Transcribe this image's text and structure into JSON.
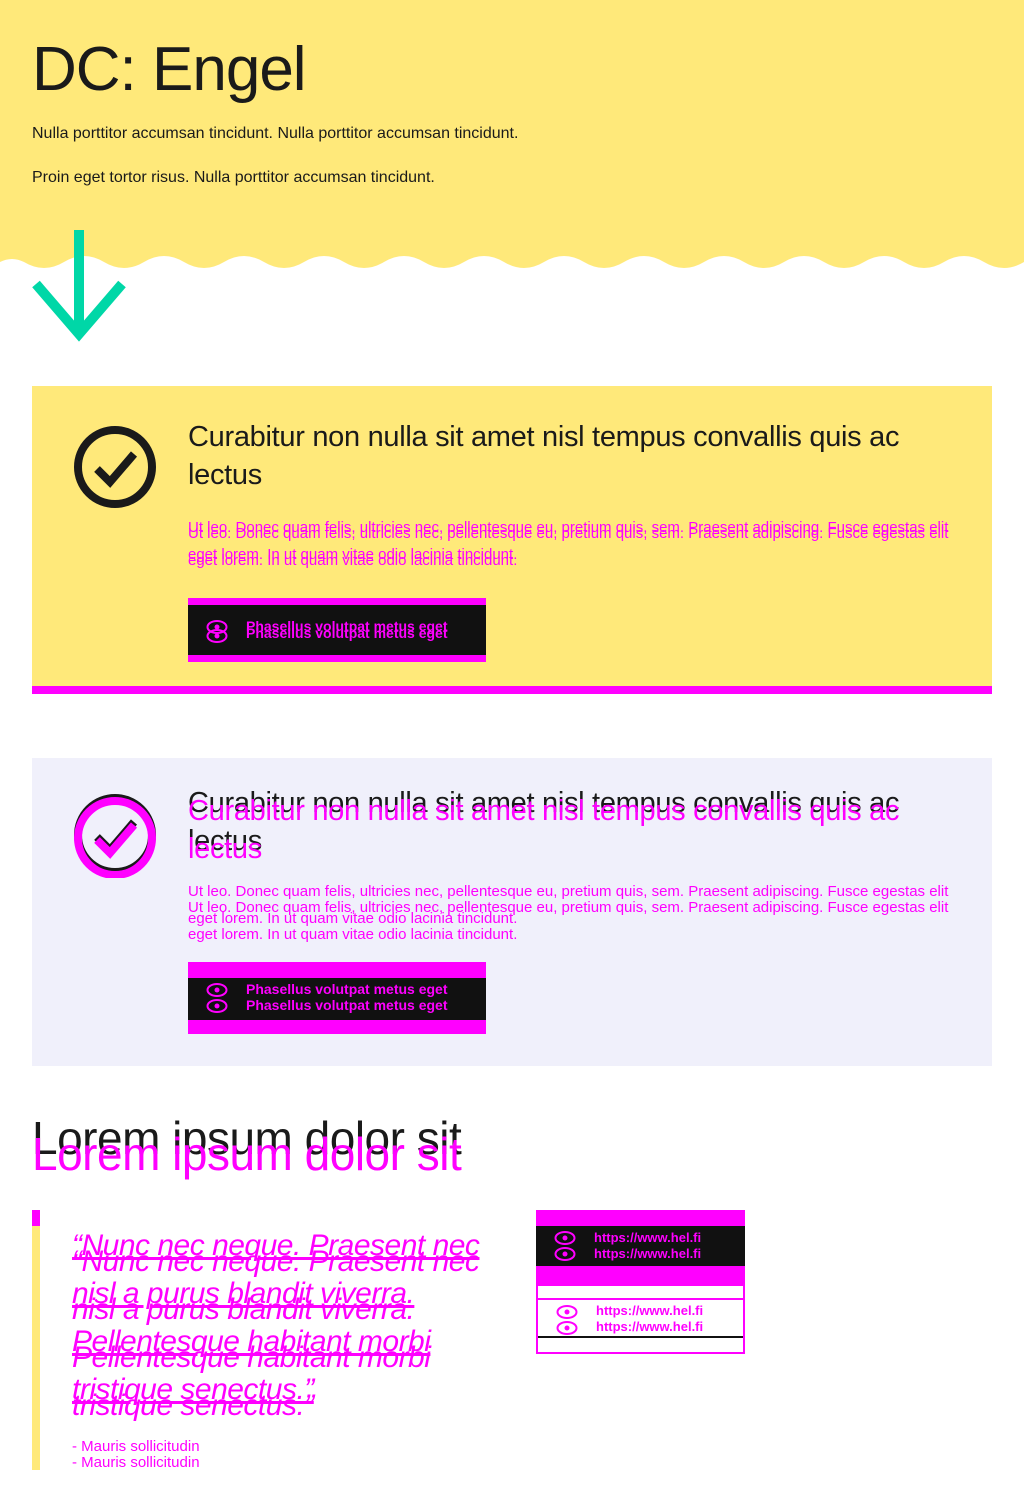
{
  "hero": {
    "title": "DC: Engel",
    "paragraph_1": "Nulla porttitor accumsan tincidunt. Nulla porttitor accumsan tincidunt.",
    "paragraph_2": "Proin eget tortor risus. Nulla porttitor accumsan tincidunt.",
    "background_color": "#ffe97a",
    "arrow_icon": "arrow-down-icon",
    "arrow_color": "#00d7a7"
  },
  "notification_1": {
    "icon": "check-circle-icon",
    "title": "Curabitur non nulla sit amet nisl tempus convallis quis ac lectus",
    "text": "Ut leo. Donec quam felis, ultricies nec, pellentesque eu, pretium quis, sem. Praesent adipiscing. Fusce egestas elit eget lorem. In ut quam vitae odio lacinia tincidunt.",
    "button_label": "Phasellus volutpat metus eget",
    "button_icon": "eye-icon",
    "background_color": "#ffe97a"
  },
  "notification_2": {
    "icon": "check-circle-icon",
    "title": "Curabitur non nulla sit amet nisl tempus convallis quis ac lectus",
    "text": "Ut leo. Donec quam felis, ultricies nec, pellentesque eu, pretium quis, sem. Praesent adipiscing. Fusce egestas elit eget lorem. In ut quam vitae odio lacinia tincidunt.",
    "button_label": "Phasellus volutpat metus eget",
    "button_icon": "eye-icon",
    "background_color": "#f0f0fb"
  },
  "section": {
    "title": "Lorem ipsum dolor sit"
  },
  "quote": {
    "text": "“Nunc nec neque. Praesent nec nisl a purus blandit viverra. Pellentesque habitant morbi tristique senectus.”",
    "author": "- Mauris sollicitudin"
  },
  "links": [
    {
      "label": "https://www.hel.fi",
      "icon": "eye-icon",
      "style": "dark"
    },
    {
      "label": "https://www.hel.fi",
      "icon": "eye-icon",
      "style": "light"
    }
  ],
  "colors": {
    "accent_magenta": "#ff00ff",
    "dark": "#111111"
  }
}
